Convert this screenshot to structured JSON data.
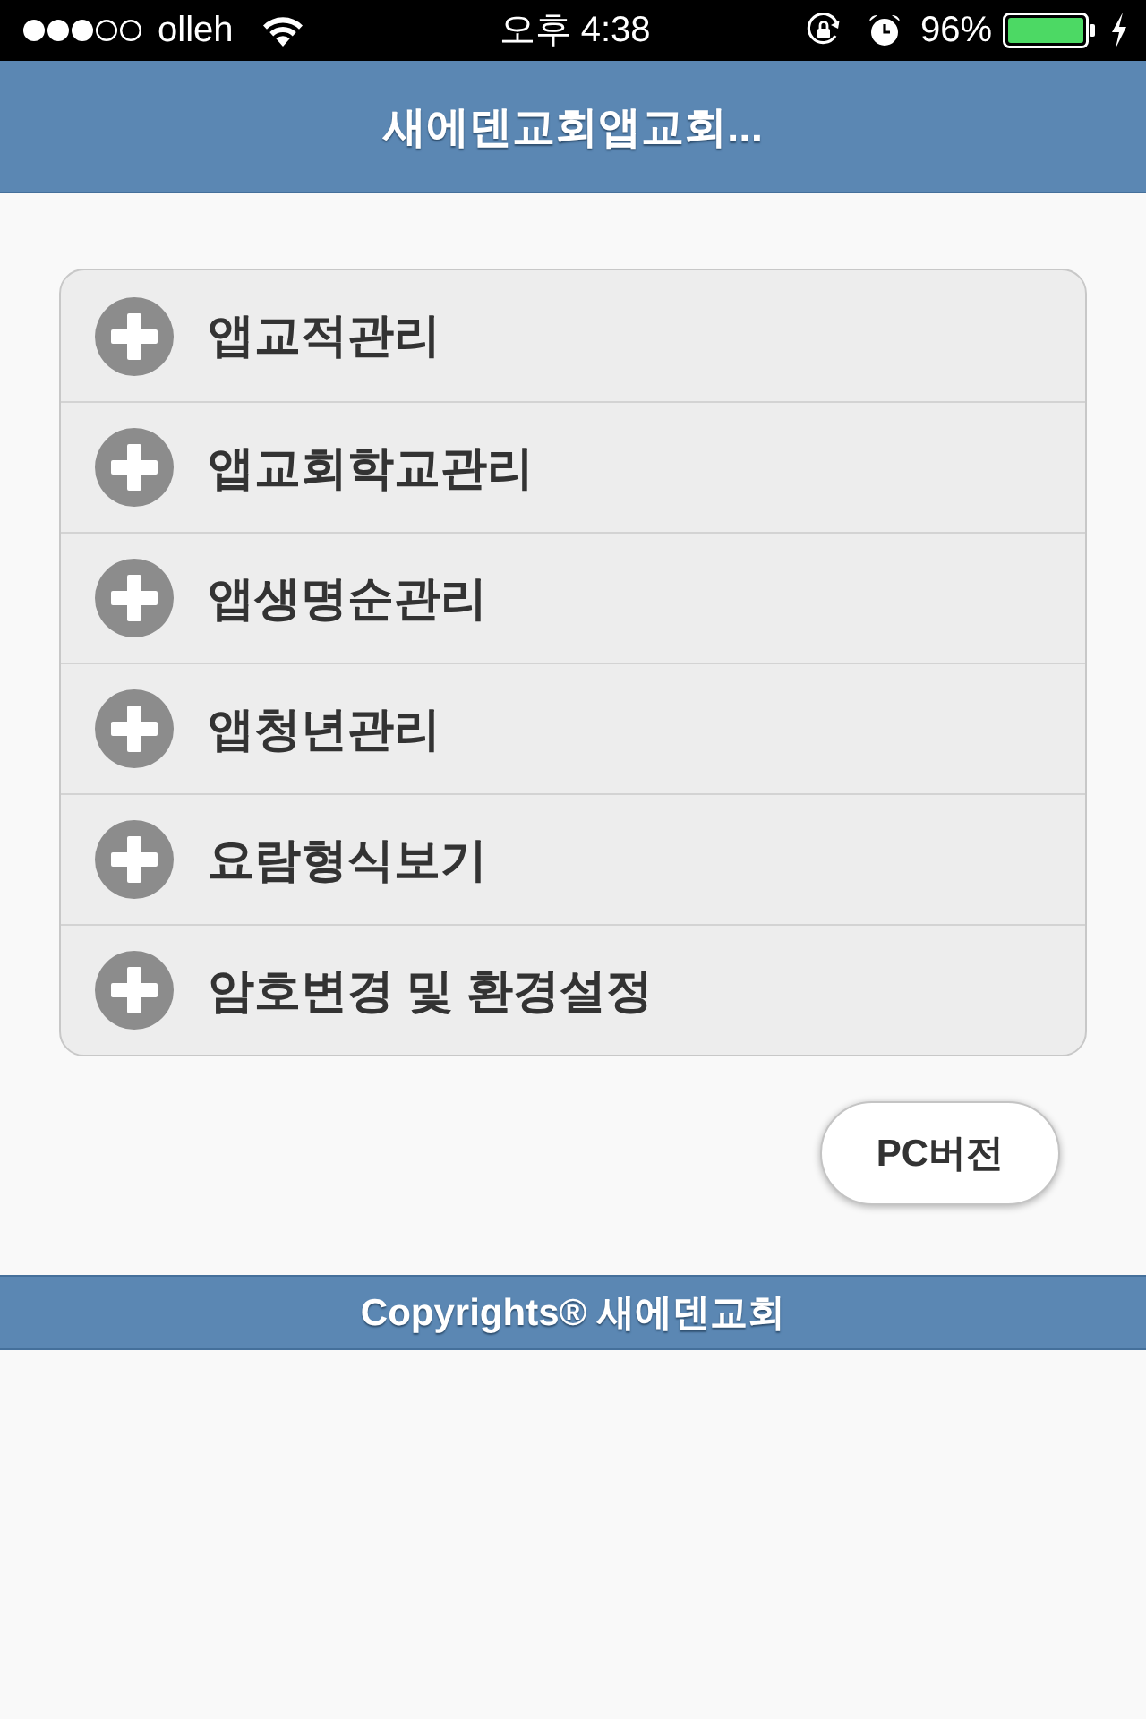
{
  "status_bar": {
    "carrier": "olleh",
    "time": "오후 4:38",
    "battery": "96%"
  },
  "header": {
    "title": "새에덴교회앱교회..."
  },
  "menu": {
    "items": [
      {
        "label": "앱교적관리"
      },
      {
        "label": "앱교회학교관리"
      },
      {
        "label": "앱생명순관리"
      },
      {
        "label": "앱청년관리"
      },
      {
        "label": "요람형식보기"
      },
      {
        "label": "암호변경 및 환경설정"
      }
    ]
  },
  "pc_button": {
    "label": "PC버전"
  },
  "footer": {
    "text": "Copyrights® 새에덴교회"
  }
}
